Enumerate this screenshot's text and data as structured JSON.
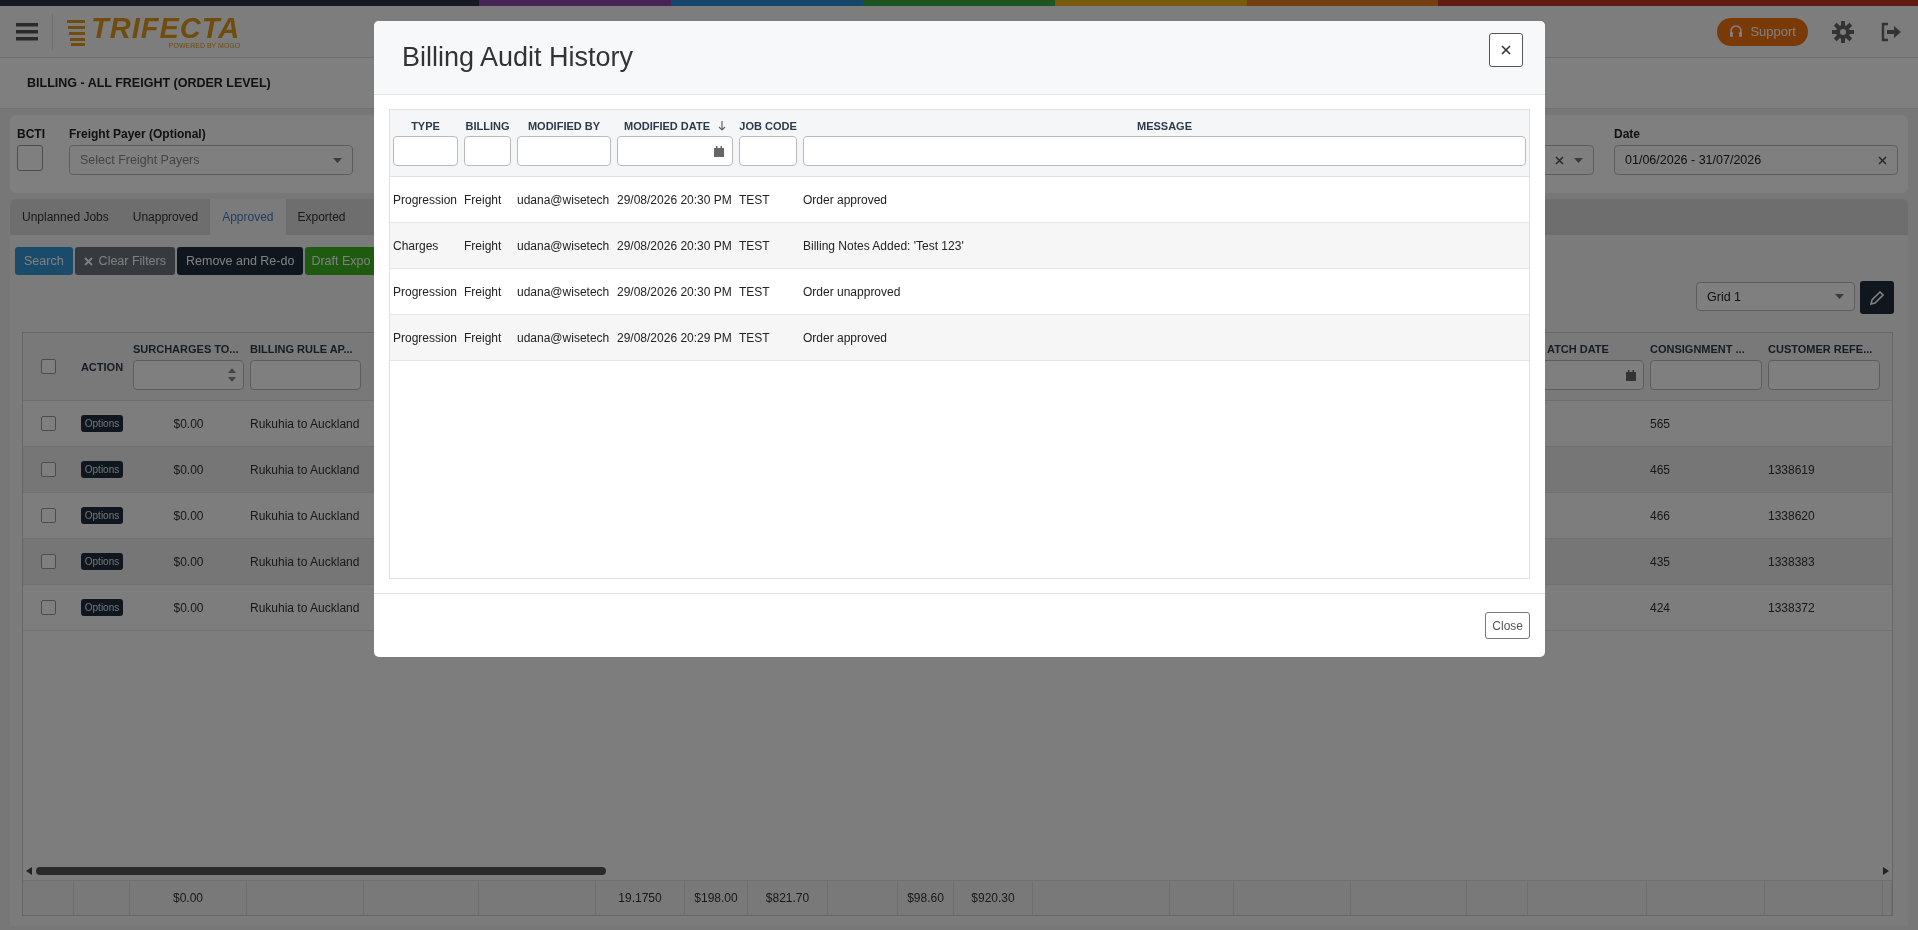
{
  "header": {
    "logo_name": "TRIFECTA",
    "logo_tagline": "POWERED BY MOGO",
    "support_label": "Support"
  },
  "page_title": "BILLING - ALL FREIGHT (ORDER LEVEL)",
  "filters": {
    "bcti": {
      "label": "BCTI",
      "checked": false
    },
    "freight_payer": {
      "label": "Freight Payer (Optional)",
      "placeholder": "Select Freight Payers"
    },
    "date": {
      "label": "Date",
      "value": "01/06/2026 - 31/07/2026"
    }
  },
  "tabs": [
    {
      "label": "Unplanned Jobs",
      "selected": false
    },
    {
      "label": "Unapproved",
      "selected": false
    },
    {
      "label": "Approved",
      "selected": true
    },
    {
      "label": "Exported",
      "selected": false
    }
  ],
  "actions": [
    {
      "label": "Search",
      "kind": "primary"
    },
    {
      "label": "Clear Filters",
      "kind": "clear"
    },
    {
      "label": "Remove and Re-do",
      "kind": "dark"
    },
    {
      "label": "Draft Expo",
      "kind": "success"
    }
  ],
  "grid_select": {
    "value": "Grid 1"
  },
  "table": {
    "select_all_checked": false,
    "action_header": "ACTION",
    "surcharges_header": "SURCHARGES TO...",
    "billing_rule_header": "BILLING RULE AP...",
    "dispatch_header": "ATCH DATE",
    "consignment_header": "CONSIGNMENT ...",
    "customer_ref_header": "CUSTOMER REFE...",
    "rows": [
      {
        "checked": false,
        "action": "Options",
        "surcharges": "$0.00",
        "billing_rule": "Rukuhia to Auckland",
        "consignment": "565"
      },
      {
        "checked": false,
        "action": "Options",
        "surcharges": "$0.00",
        "billing_rule": "Rukuhia to Auckland",
        "consignment": "465",
        "customer_ref": "1338619"
      },
      {
        "checked": false,
        "action": "Options",
        "surcharges": "$0.00",
        "billing_rule": "Rukuhia to Auckland",
        "consignment": "466",
        "customer_ref": "1338620"
      },
      {
        "checked": false,
        "action": "Options",
        "surcharges": "$0.00",
        "billing_rule": "Rukuhia to Auckland",
        "consignment": "435",
        "customer_ref": "1338383"
      },
      {
        "checked": false,
        "action": "Options",
        "surcharges": "$0.00",
        "billing_rule": "Rukuhia to Auckland",
        "consignment": "424",
        "customer_ref": "1338372"
      }
    ],
    "totals": [
      "$0.00",
      "19.1750",
      "$198.00",
      "$821.70",
      "$98.60",
      "$920.30"
    ]
  },
  "modal": {
    "title": "Billing Audit History",
    "close_label": "Close",
    "columns": [
      "TYPE",
      "BILLING",
      "MODIFIED BY",
      "MODIFIED DATE",
      "JOB CODE",
      "MESSAGE"
    ],
    "rows": [
      {
        "type": "Progression",
        "billing": "Freight",
        "modified_by": "udana@wisetech",
        "modified_date": "29/08/2026 20:30 PM",
        "job_code": "TEST",
        "message": "Order approved"
      },
      {
        "type": "Charges",
        "billing": "Freight",
        "modified_by": "udana@wisetech",
        "modified_date": "29/08/2026 20:30 PM",
        "job_code": "TEST",
        "message": "Billing Notes Added: 'Test 123'"
      },
      {
        "type": "Progression",
        "billing": "Freight",
        "modified_by": "udana@wisetech",
        "modified_date": "29/08/2026 20:30 PM",
        "job_code": "TEST",
        "message": "Order unapproved"
      },
      {
        "type": "Progression",
        "billing": "Freight",
        "modified_by": "udana@wisetech",
        "modified_date": "29/08/2026 20:29 PM",
        "job_code": "TEST",
        "message": "Order approved"
      }
    ]
  }
}
